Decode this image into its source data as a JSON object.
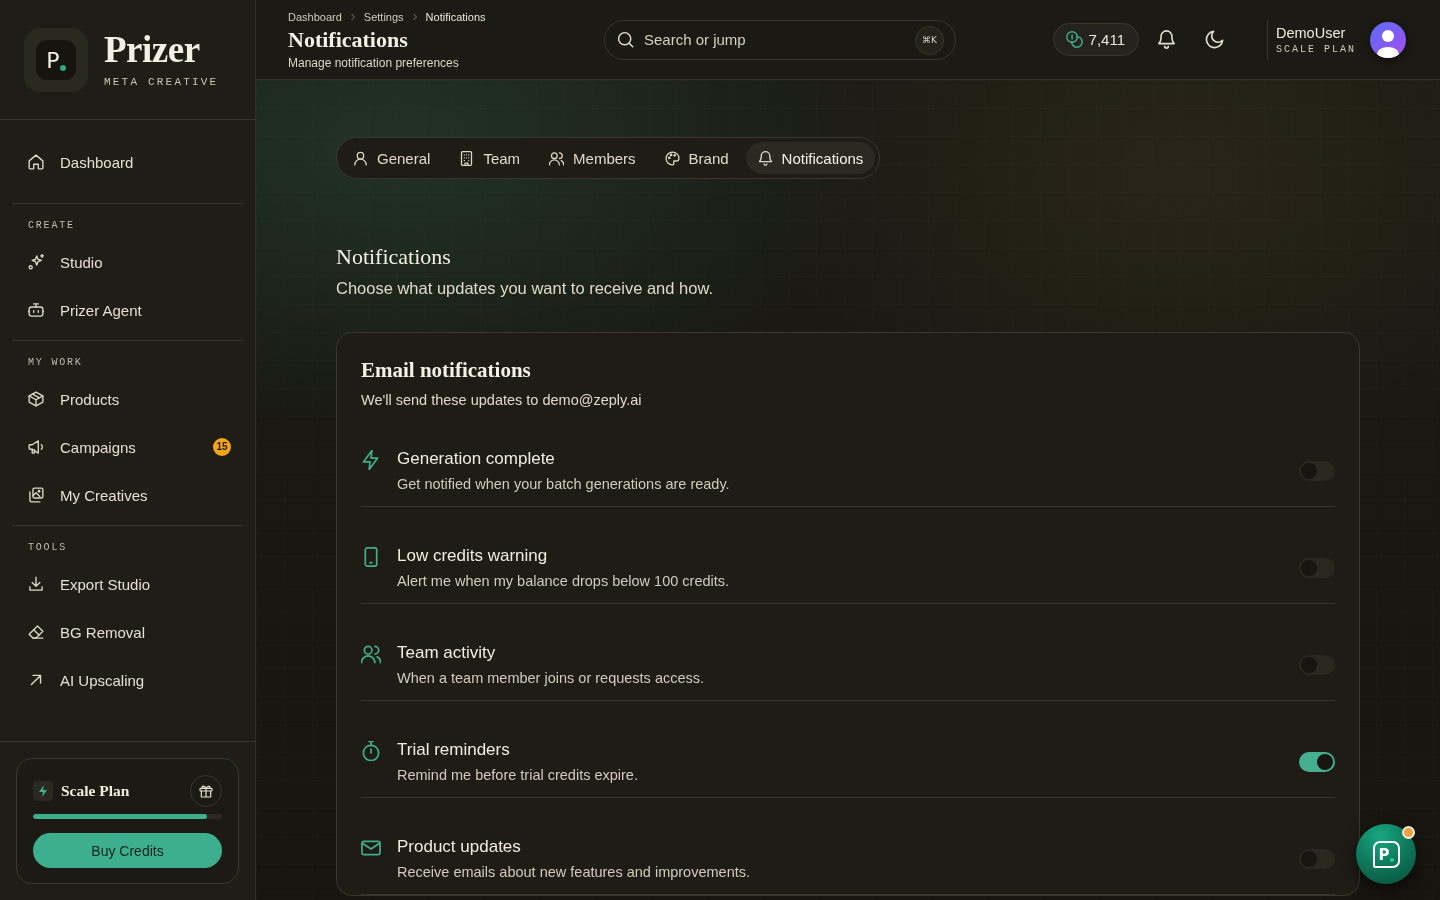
{
  "sidebar": {
    "brand": {
      "mark": "P",
      "name": "Prizer",
      "tagline": "META CREATIVE"
    },
    "sections": [
      {
        "items": [
          {
            "label": "Dashboard",
            "selected": false
          }
        ]
      },
      {
        "title": "CREATE",
        "items": [
          {
            "label": "Studio",
            "selected": false
          },
          {
            "label": "Prizer Agent",
            "selected": false
          }
        ]
      },
      {
        "title": "MY WORK",
        "items": [
          {
            "label": "Products",
            "selected": false
          },
          {
            "label": "Campaigns",
            "badge": "15",
            "selected": false
          },
          {
            "label": "My Creatives",
            "selected": false
          }
        ]
      },
      {
        "title": "TOOLS",
        "items": [
          {
            "label": "Export Studio",
            "selected": false
          },
          {
            "label": "BG Removal",
            "selected": false
          },
          {
            "label": "AI Upscaling",
            "selected": false
          }
        ]
      }
    ],
    "plan_card": {
      "title": "Scale Plan",
      "level": 0.92,
      "button": "Buy Credits"
    }
  },
  "header": {
    "breadcrumbs": [
      "Dashboard",
      "Settings",
      "Notifications"
    ],
    "title": "Notifications",
    "subtitle": "Manage notification preferences",
    "search": {
      "placeholder": "Search or jump",
      "shortcut": "⌘K"
    },
    "credits": "7,411",
    "user": {
      "name": "DemoUser",
      "plan": "SCALE PLAN"
    }
  },
  "tabs": [
    {
      "label": "General",
      "selected": false
    },
    {
      "label": "Team",
      "selected": false
    },
    {
      "label": "Members",
      "selected": false
    },
    {
      "label": "Brand",
      "selected": false
    },
    {
      "label": "Notifications",
      "selected": true
    }
  ],
  "section": {
    "title": "Notifications",
    "subtitle": "Choose what updates you want to receive and how."
  },
  "email_card": {
    "title": "Email notifications",
    "subtitle": "We'll send these updates to demo@zeply.ai",
    "items": [
      {
        "title": "Generation complete",
        "description": "Get notified when your batch generations are ready.",
        "on": false
      },
      {
        "title": "Low credits warning",
        "description": "Alert me when my balance drops below 100 credits.",
        "on": false
      },
      {
        "title": "Team activity",
        "description": "When a team member joins or requests access.",
        "on": false
      },
      {
        "title": "Trial reminders",
        "description": "Remind me before trial credits expire.",
        "on": true
      },
      {
        "title": "Product updates",
        "description": "Receive emails about new features and improvements.",
        "on": false
      }
    ]
  },
  "chat_button": {
    "mark": "P"
  }
}
